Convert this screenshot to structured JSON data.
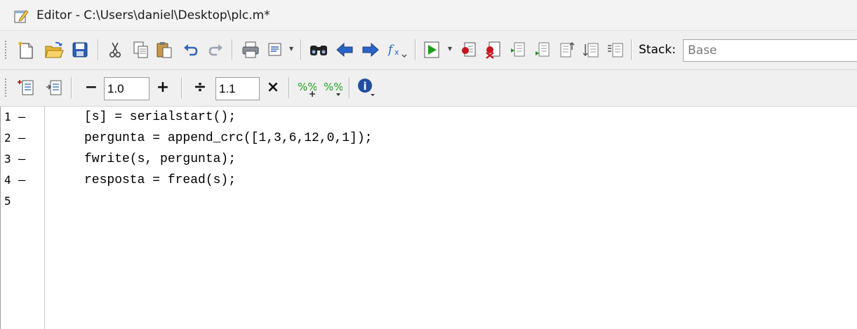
{
  "window": {
    "title": "Editor - C:\\Users\\daniel\\Desktop\\plc.m*"
  },
  "toolbar": {
    "stack_label": "Stack:",
    "stack_value": "Base",
    "icons": [
      "new-file",
      "open-folder",
      "save",
      "cut",
      "copy",
      "paste",
      "undo",
      "redo",
      "print",
      "comment",
      "find",
      "back",
      "forward",
      "function",
      "run",
      "step",
      "clear-breakpoint",
      "breakpoint-stack",
      "evaluate",
      "step-in",
      "step-out",
      "continue",
      "exit-debug"
    ]
  },
  "cell_toolbar": {
    "minus_label": "−",
    "plus_label": "+",
    "divide_label": "÷",
    "times_label": "×",
    "add_value": "1.0",
    "multiply_value": "1.1"
  },
  "editor": {
    "lines": [
      {
        "number": "1",
        "marker": "—",
        "code": "[s] = serialstart();"
      },
      {
        "number": "2",
        "marker": "—",
        "code": "pergunta = append_crc([1,3,6,12,0,1]);"
      },
      {
        "number": "3",
        "marker": "—",
        "code": "fwrite(s, pergunta);"
      },
      {
        "number": "4",
        "marker": "—",
        "code": "resposta = fread(s);"
      },
      {
        "number": "5",
        "marker": "",
        "code": ""
      }
    ]
  },
  "colors": {
    "accent": "#2a64c8",
    "run_green": "#1aa11a",
    "breakpoint_red": "#c8141e"
  }
}
